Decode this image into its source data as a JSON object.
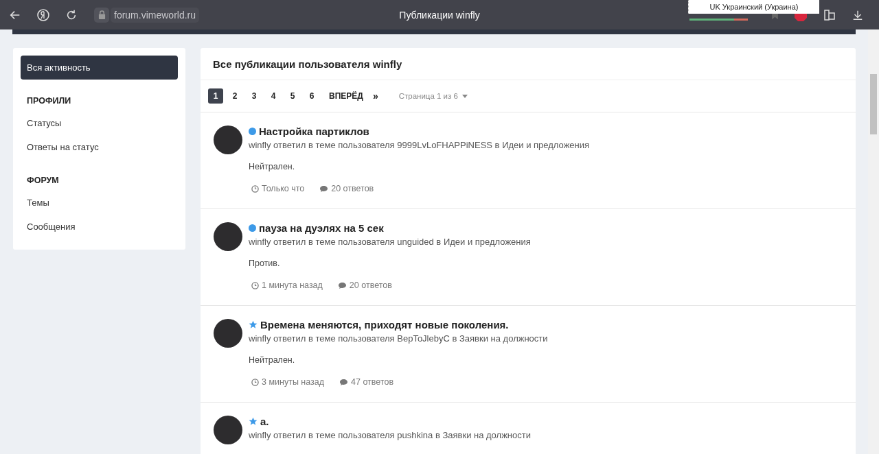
{
  "browser": {
    "url": "forum.vimeworld.ru",
    "title": "Публикации winfly",
    "language_popup": "UK Украинский (Украина)"
  },
  "sidebar": {
    "items": [
      {
        "kind": "link",
        "label": "Вся активность",
        "selected": true
      },
      {
        "kind": "heading",
        "label": "ПРОФИЛИ"
      },
      {
        "kind": "link",
        "label": "Статусы",
        "selected": false
      },
      {
        "kind": "link",
        "label": "Ответы на статус",
        "selected": false
      },
      {
        "kind": "heading",
        "label": "ФОРУМ"
      },
      {
        "kind": "link",
        "label": "Темы",
        "selected": false
      },
      {
        "kind": "link",
        "label": "Сообщения",
        "selected": false
      }
    ]
  },
  "main": {
    "title": "Все публикации пользователя winfly",
    "pagination": {
      "pages": [
        {
          "label": "1",
          "selected": true
        },
        {
          "label": "2",
          "selected": false
        },
        {
          "label": "3",
          "selected": false
        },
        {
          "label": "4",
          "selected": false
        },
        {
          "label": "5",
          "selected": false
        },
        {
          "label": "6",
          "selected": false
        }
      ],
      "next": "ВПЕРЁД",
      "last": "»",
      "page_info": "Страница 1 из 6"
    },
    "posts": [
      {
        "kind": "dot",
        "title": "Настройка партиклов",
        "meta": "winfly ответил в теме пользователя 9999LvLoFHAPPiNESS в Идеи и предложения",
        "excerpt": "Нейтрален.",
        "time": "Только что",
        "replies": "20 ответов"
      },
      {
        "kind": "dot",
        "title": "пауза на дуэлях на 5 сек",
        "meta": "winfly ответил в теме пользователя unguided в Идеи и предложения",
        "excerpt": "Против.",
        "time": "1 минута назад",
        "replies": "20 ответов"
      },
      {
        "kind": "star",
        "title": "Времена меняются, приходят новые поколения.",
        "meta": "winfly ответил в теме пользователя BepToJlebyC в Заявки на должности",
        "excerpt": "Нейтрален.",
        "time": "3 минуты назад",
        "replies": "47 ответов"
      },
      {
        "kind": "star",
        "title": "a.",
        "meta": "winfly ответил в теме пользователя pushkina в Заявки на должности"
      }
    ]
  }
}
